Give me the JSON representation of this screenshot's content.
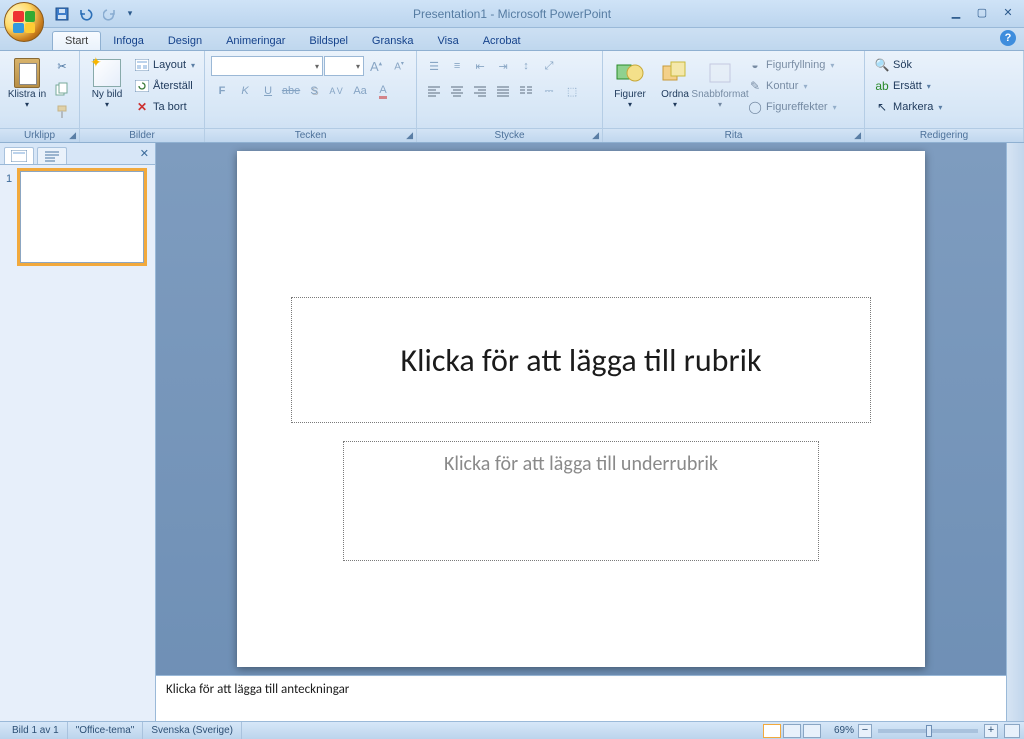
{
  "window": {
    "title": "Presentation1 - Microsoft PowerPoint"
  },
  "tabs": [
    "Start",
    "Infoga",
    "Design",
    "Animeringar",
    "Bildspel",
    "Granska",
    "Visa",
    "Acrobat"
  ],
  "activeTab": "Start",
  "ribbon": {
    "clipboard": {
      "label": "Urklipp",
      "paste": "Klistra in"
    },
    "slides": {
      "label": "Bilder",
      "new": "Ny bild",
      "layout": "Layout",
      "reset": "Återställ",
      "delete": "Ta bort"
    },
    "font": {
      "label": "Tecken",
      "fontName": "",
      "fontSize": ""
    },
    "paragraph": {
      "label": "Stycke"
    },
    "drawing": {
      "label": "Rita",
      "shapes": "Figurer",
      "arrange": "Ordna",
      "quickstyles": "Snabbformat",
      "fill": "Figurfyllning",
      "outline": "Kontur",
      "effects": "Figureffekter"
    },
    "editing": {
      "label": "Redigering",
      "find": "Sök",
      "replace": "Ersätt",
      "select": "Markera"
    }
  },
  "slide": {
    "titlePlaceholder": "Klicka för att lägga till rubrik",
    "subtitlePlaceholder": "Klicka för att lägga till underrubrik"
  },
  "thumbnails": [
    {
      "number": "1",
      "selected": true
    }
  ],
  "notesPlaceholder": "Klicka för att lägga till anteckningar",
  "status": {
    "slideInfo": "Bild 1 av 1",
    "theme": "\"Office-tema\"",
    "language": "Svenska (Sverige)",
    "zoom": "69%"
  }
}
